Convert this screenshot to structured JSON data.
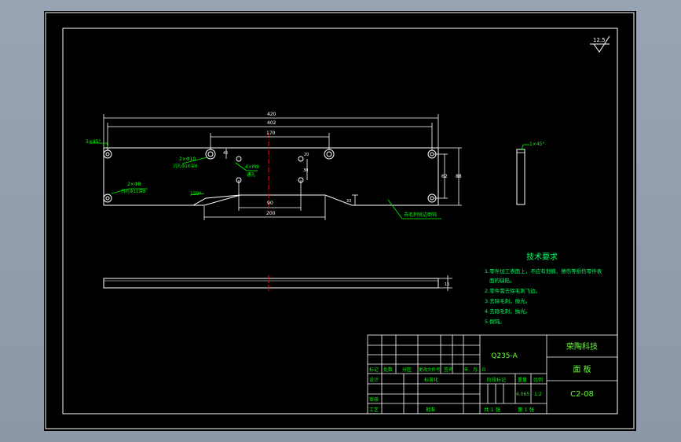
{
  "colors": {
    "background": "#000000",
    "outline": "#ffffff",
    "dimension": "#ffffff",
    "annotation": "#00ff00",
    "centerline": "#ff0000",
    "text_note": "#00ff66",
    "title_text": "#66ff33",
    "table_text": "#00ff00"
  },
  "surface_finish": "12.5",
  "dimensions": {
    "overall_length": "420",
    "hole_span": "402",
    "inner_span": "170",
    "bottom_span": "200",
    "center_offset": "90",
    "small_v": "45",
    "small_h": "20",
    "mid_h": "30",
    "height_right": "62",
    "height_total": "88",
    "slot_height": "33",
    "thickness": "15",
    "chamfer_left": "3×45°",
    "chamfer_side": "1×45°",
    "angle": "150°"
  },
  "annotations": {
    "hole_callout_top": "2×Φ10",
    "hole_callout_top_sub": "沉孔Φ16深8",
    "hole_callout_bottom": "2×Φ8",
    "hole_callout_bottom_sub": "沉孔Φ11深8",
    "tap_callout": "4×M8",
    "tap_callout_sub": "通孔",
    "edge_note": "去毛刺锐边倒钝"
  },
  "tech_requirements": {
    "title": "技术要求",
    "items": [
      "1.零件加工表面上，不应有划痕、擦伤等损伤零件表",
      "面的缺陷。",
      "2.零件需去除毛刺飞边。",
      "3.去除毛刺，抛光。",
      "4.去除毛刺，抛光。",
      "5.倒钝。"
    ]
  },
  "title_block": {
    "material": "Q235-A",
    "company": "荣陶科技",
    "part_name": "面  板",
    "drawing_no": "C2-08",
    "weight": "4.065",
    "scale": "1:2",
    "sheet_total": "共  1  张",
    "sheet_no": "第  1  张",
    "headers": [
      "标记",
      "处数",
      "分区",
      "更改文件号",
      "签名",
      "年、月、日"
    ],
    "stage_label": "阶段标记",
    "weight_label": "重量",
    "scale_label": "比例",
    "design": "设计",
    "standardize": "标准化",
    "review": "审核",
    "process": "工艺",
    "approve": "批准"
  }
}
